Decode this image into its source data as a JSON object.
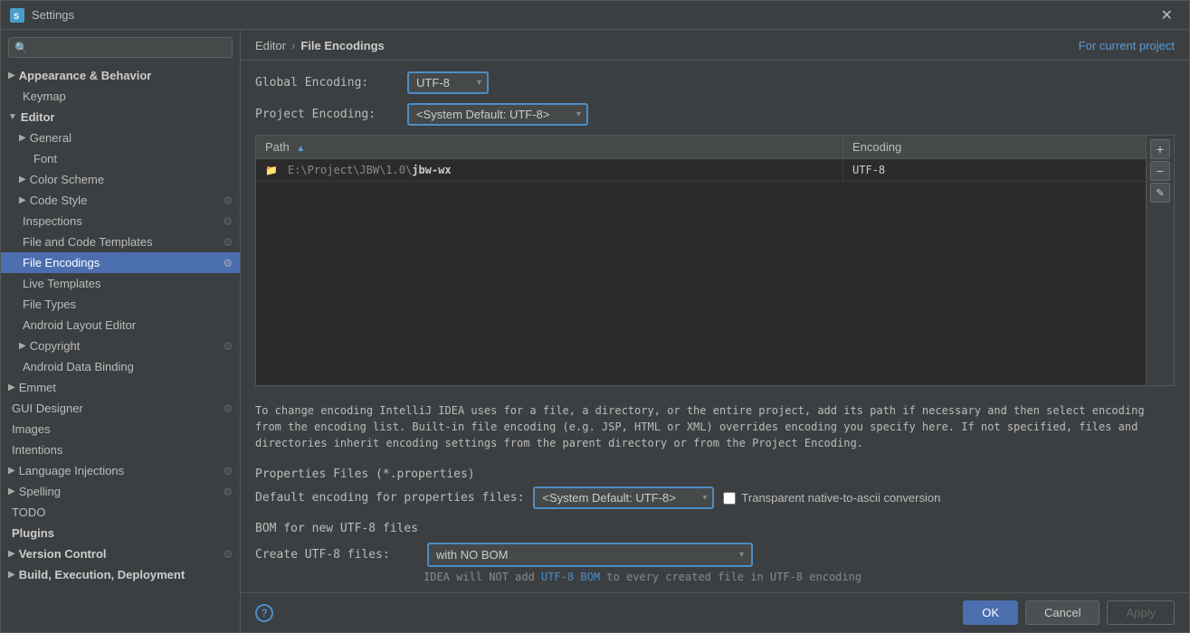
{
  "window": {
    "title": "Settings",
    "icon": "S"
  },
  "sidebar": {
    "search_placeholder": "🔍",
    "items": [
      {
        "id": "appearance",
        "label": "Appearance & Behavior",
        "level": 0,
        "arrow": "▶",
        "bold": true,
        "gear": false,
        "selected": false
      },
      {
        "id": "keymap",
        "label": "Keymap",
        "level": 1,
        "arrow": "",
        "bold": false,
        "gear": false,
        "selected": false
      },
      {
        "id": "editor",
        "label": "Editor",
        "level": 0,
        "arrow": "▼",
        "bold": true,
        "gear": false,
        "selected": false
      },
      {
        "id": "general",
        "label": "General",
        "level": 1,
        "arrow": "▶",
        "bold": false,
        "gear": false,
        "selected": false
      },
      {
        "id": "font",
        "label": "Font",
        "level": 2,
        "arrow": "",
        "bold": false,
        "gear": false,
        "selected": false
      },
      {
        "id": "colorscheme",
        "label": "Color Scheme",
        "level": 1,
        "arrow": "▶",
        "bold": false,
        "gear": false,
        "selected": false
      },
      {
        "id": "codestyle",
        "label": "Code Style",
        "level": 1,
        "arrow": "▶",
        "bold": false,
        "gear": true,
        "selected": false
      },
      {
        "id": "inspections",
        "label": "Inspections",
        "level": 1,
        "arrow": "",
        "bold": false,
        "gear": true,
        "selected": false
      },
      {
        "id": "filecodetemp",
        "label": "File and Code Templates",
        "level": 1,
        "arrow": "",
        "bold": false,
        "gear": true,
        "selected": false
      },
      {
        "id": "fileencodings",
        "label": "File Encodings",
        "level": 1,
        "arrow": "",
        "bold": false,
        "gear": true,
        "selected": true
      },
      {
        "id": "livetemplates",
        "label": "Live Templates",
        "level": 1,
        "arrow": "",
        "bold": false,
        "gear": false,
        "selected": false
      },
      {
        "id": "filetypes",
        "label": "File Types",
        "level": 1,
        "arrow": "",
        "bold": false,
        "gear": false,
        "selected": false
      },
      {
        "id": "androidlayout",
        "label": "Android Layout Editor",
        "level": 1,
        "arrow": "",
        "bold": false,
        "gear": false,
        "selected": false
      },
      {
        "id": "copyright",
        "label": "Copyright",
        "level": 1,
        "arrow": "▶",
        "bold": false,
        "gear": true,
        "selected": false
      },
      {
        "id": "androiddatabinding",
        "label": "Android Data Binding",
        "level": 1,
        "arrow": "",
        "bold": false,
        "gear": false,
        "selected": false
      },
      {
        "id": "emmet",
        "label": "Emmet",
        "level": 0,
        "arrow": "▶",
        "bold": false,
        "gear": false,
        "selected": false
      },
      {
        "id": "guidesigner",
        "label": "GUI Designer",
        "level": 0,
        "arrow": "",
        "bold": false,
        "gear": true,
        "selected": false
      },
      {
        "id": "images",
        "label": "Images",
        "level": 0,
        "arrow": "",
        "bold": false,
        "gear": false,
        "selected": false
      },
      {
        "id": "intentions",
        "label": "Intentions",
        "level": 0,
        "arrow": "",
        "bold": false,
        "gear": false,
        "selected": false
      },
      {
        "id": "langinjections",
        "label": "Language Injections",
        "level": 0,
        "arrow": "▶",
        "bold": false,
        "gear": true,
        "selected": false
      },
      {
        "id": "spelling",
        "label": "Spelling",
        "level": 0,
        "arrow": "▶",
        "bold": false,
        "gear": true,
        "selected": false
      },
      {
        "id": "todo",
        "label": "TODO",
        "level": 0,
        "arrow": "",
        "bold": false,
        "gear": false,
        "selected": false
      },
      {
        "id": "plugins",
        "label": "Plugins",
        "level": 0,
        "arrow": "",
        "bold": true,
        "gear": false,
        "selected": false
      },
      {
        "id": "versioncontrol",
        "label": "Version Control",
        "level": 0,
        "arrow": "▶",
        "bold": true,
        "gear": true,
        "selected": false
      },
      {
        "id": "buildexec",
        "label": "Build, Execution, Deployment",
        "level": 0,
        "arrow": "▶",
        "bold": true,
        "gear": false,
        "selected": false
      }
    ]
  },
  "breadcrumb": {
    "path1": "Editor",
    "separator": "›",
    "path2": "File Encodings",
    "link": "For current project"
  },
  "global_encoding": {
    "label": "Global Encoding:",
    "value": "UTF-8"
  },
  "project_encoding": {
    "label": "Project Encoding:",
    "value": "<System Default: UTF-8>"
  },
  "table": {
    "columns": [
      "Path",
      "Encoding"
    ],
    "sort_col": "Path",
    "rows": [
      {
        "path": "E:\\Project\\JBW\\1.0\\jbw-wx",
        "path_prefix": "E:\\Project\\JBW\\1.0\\",
        "path_bold": "jbw-wx",
        "encoding": "UTF-8"
      }
    ]
  },
  "info_text": "To change encoding IntelliJ IDEA uses for a file, a directory, or the entire project, add its path if necessary and then select encoding from the encoding list. Built-in file encoding (e.g. JSP, HTML or XML) overrides encoding you specify here. If not specified, files and directories inherit encoding settings from the parent directory or from the Project Encoding.",
  "properties_section": {
    "title": "Properties Files (*.properties)",
    "default_encoding_label": "Default encoding for properties files:",
    "default_encoding_value": "<System Default: UTF-8>",
    "transparent_label": "Transparent native-to-ascii conversion",
    "transparent_checked": false
  },
  "bom_section": {
    "title": "BOM for new UTF-8 files",
    "create_label": "Create UTF-8 files:",
    "create_value": "with NO BOM",
    "hint_pre": "IDEA will NOT add ",
    "hint_link": "UTF-8 BOM",
    "hint_post": " to every created file in UTF-8 encoding"
  },
  "footer": {
    "ok_label": "OK",
    "cancel_label": "Cancel",
    "apply_label": "Apply"
  }
}
